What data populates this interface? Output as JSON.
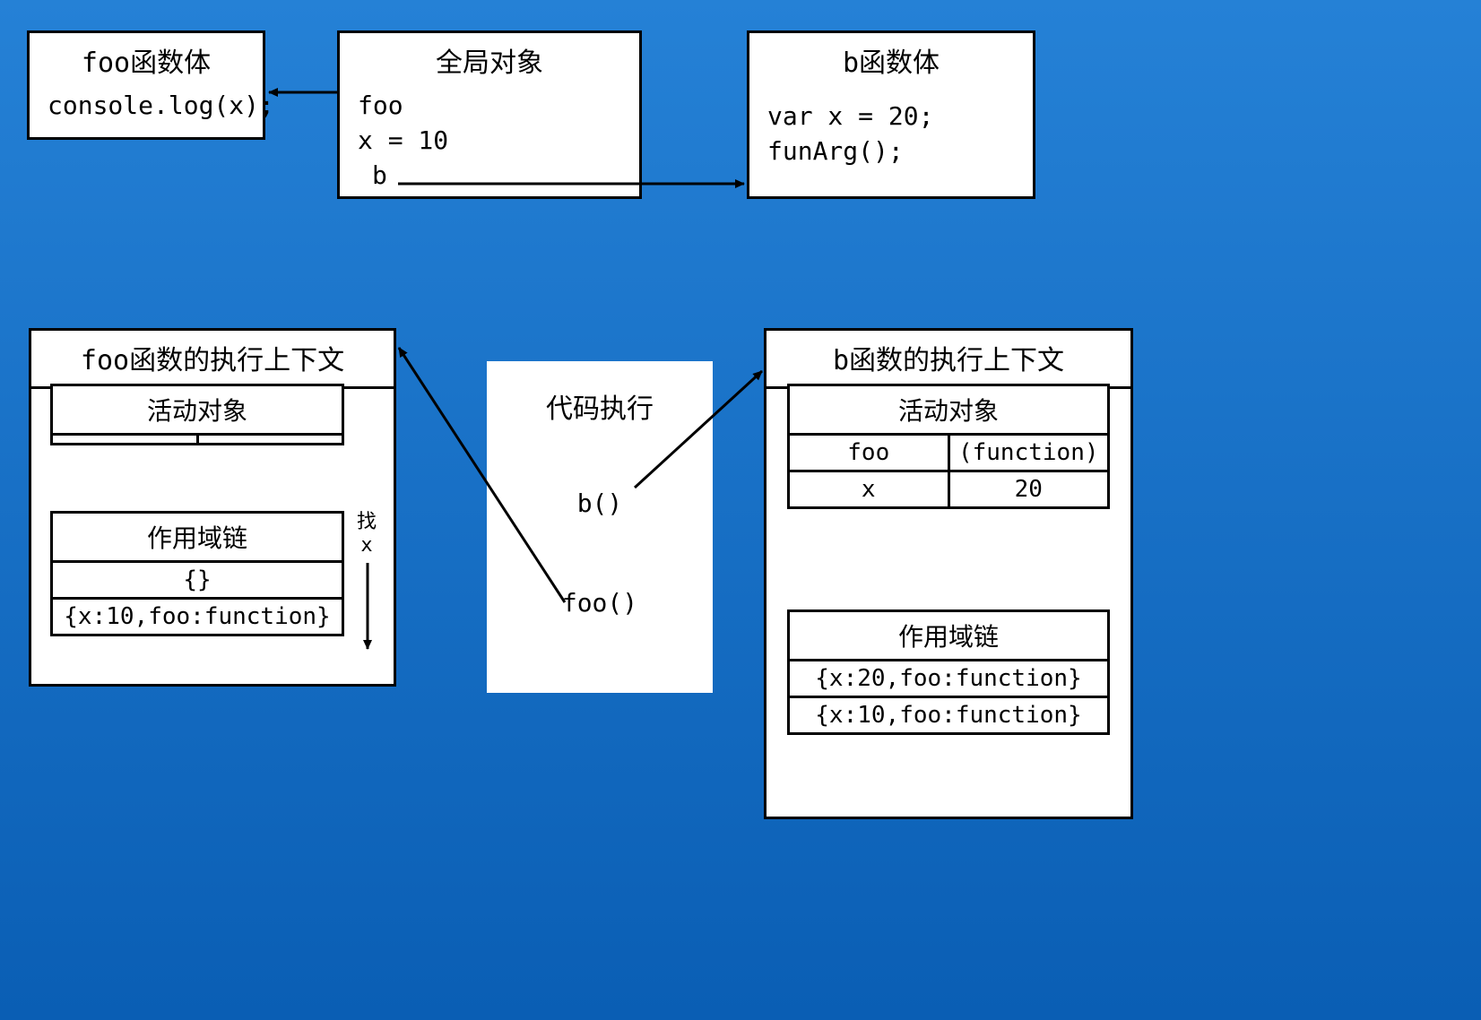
{
  "fooBody": {
    "title": "foo函数体",
    "code1": "console.log(x);"
  },
  "globalObj": {
    "title": "全局对象",
    "l1": "foo",
    "l2": "x = 10",
    "l3": "b"
  },
  "bBody": {
    "title": "b函数体",
    "l1": "var x = 20;",
    "l2": "funArg();"
  },
  "fooCtx": {
    "title": "foo函数的执行上下文",
    "activeObj": "活动对象",
    "aoRow": "",
    "scopeChain": "作用域链",
    "sc1": "{}",
    "sc2": "{x:10,foo:function}"
  },
  "codeExec": {
    "title": "代码执行",
    "l1": "b()",
    "l2": "foo()"
  },
  "bCtx": {
    "title": "b函数的执行上下文",
    "activeObj": "活动对象",
    "aoK1": "foo",
    "aoV1": "(function)",
    "aoK2": "x",
    "aoV2": "20",
    "scopeChain": "作用域链",
    "sc1": "{x:20,foo:function}",
    "sc2": "{x:10,foo:function}"
  },
  "findX": {
    "l1": "找",
    "l2": "x"
  }
}
